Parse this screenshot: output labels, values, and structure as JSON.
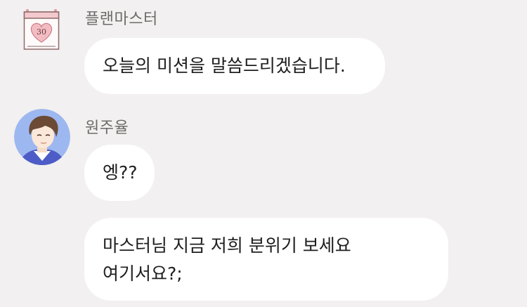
{
  "messages": [
    {
      "sender": "플랜마스터",
      "avatar": "calendar-heart-icon",
      "avatar_day": "30",
      "text": "오늘의 미션을 말씀드리겠습니다."
    },
    {
      "sender": "원주율",
      "avatar": "user-avatar",
      "text": "엥??"
    },
    {
      "sender": "원주율",
      "text": "마스터님 지금 저희 분위기 보세요 여기서요?;"
    }
  ],
  "colors": {
    "background": "#f2f0f0",
    "bubble": "#ffffff",
    "sender_text": "#6f6a6a",
    "message_text": "#1e1e1e",
    "calendar_accent": "#e79aa2",
    "avatar_bg": "#9db8f0"
  }
}
